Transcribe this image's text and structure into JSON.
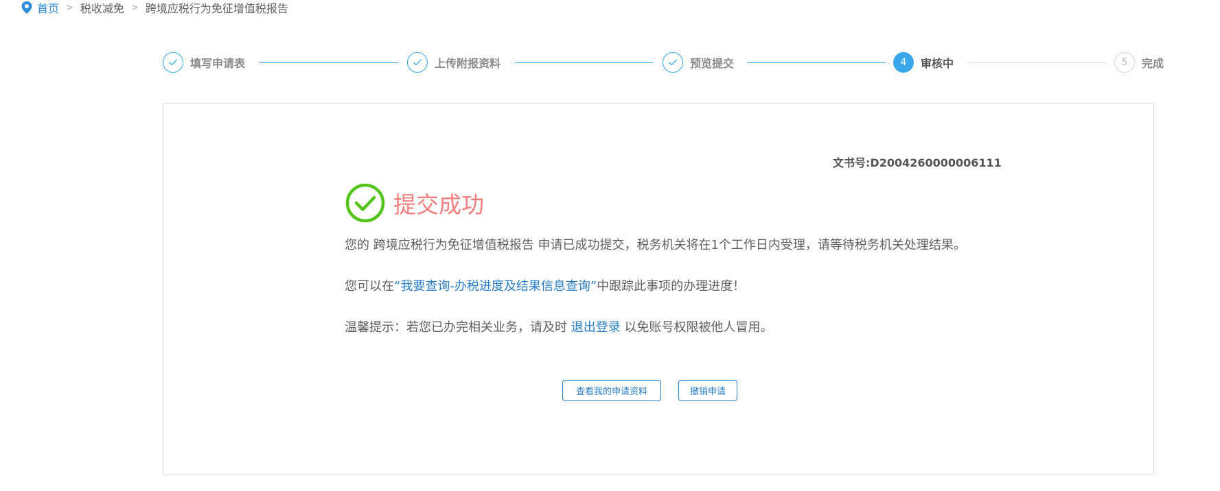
{
  "breadcrumb": {
    "home": "首页",
    "separator": ">",
    "level1": "税收减免",
    "level2": "跨境应税行为免征增值税报告"
  },
  "steps": [
    {
      "label": "填写申请表",
      "state": "done"
    },
    {
      "label": "上传附报资料",
      "state": "done"
    },
    {
      "label": "预览提交",
      "state": "done"
    },
    {
      "label": "审核中",
      "number": "4",
      "state": "active"
    },
    {
      "label": "完成",
      "number": "5",
      "state": "pending"
    }
  ],
  "result": {
    "doc_no_label": "文书号:",
    "doc_no": "D2004260000006111",
    "title": "提交成功",
    "message1": "您的 跨境应税行为免征增值税报告 申请已成功提交，税务机关将在1个工作日内受理，请等待税务机关处理结果。",
    "message2_prefix": "您可以在",
    "message2_link": "“我要查询-办税进度及结果信息查询”",
    "message2_suffix": "中跟踪此事项的办理进度！",
    "message3_prefix": "温馨提示：若您已办完相关业务，请及时 ",
    "message3_link": "退出登录",
    "message3_suffix": " 以免账号权限被他人冒用。"
  },
  "buttons": {
    "view_label": "查看我的申请资料",
    "cancel_label": "撤销申请"
  },
  "colors": {
    "accent_blue": "#3aa7ea",
    "link_blue": "#2a7dc7",
    "success_green": "#52c41a",
    "success_title": "#f27f7f"
  }
}
